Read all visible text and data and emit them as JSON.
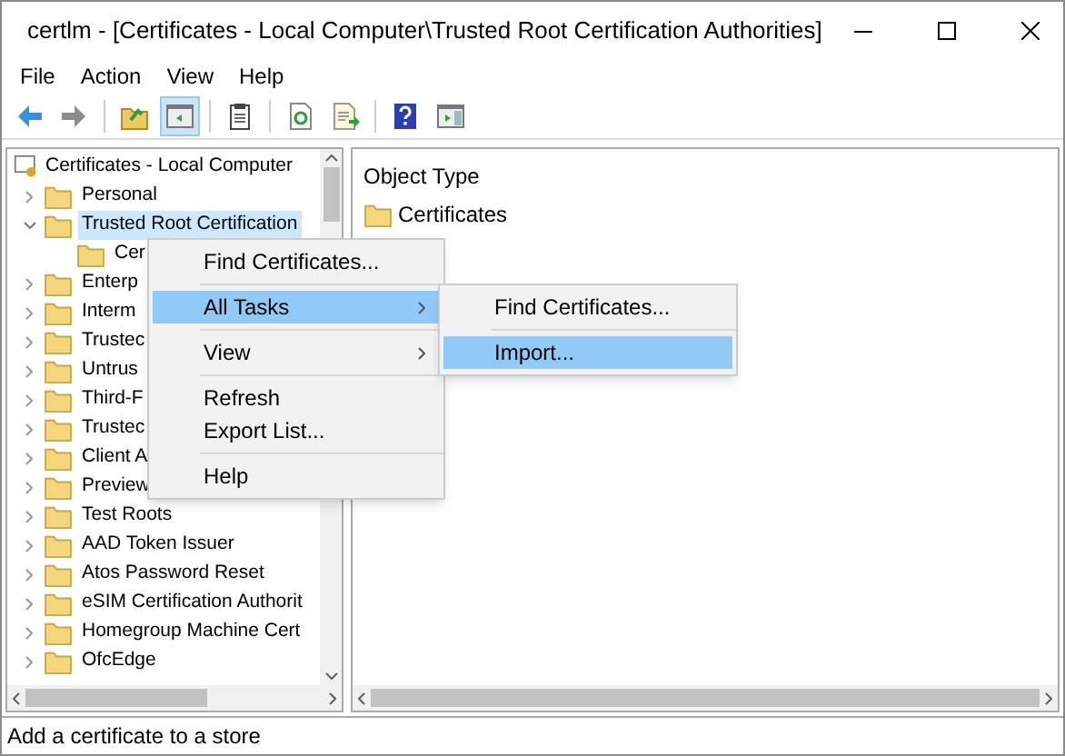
{
  "window": {
    "title": "certlm - [Certificates - Local Computer\\Trusted Root Certification Authorities]"
  },
  "menu_bar": [
    "File",
    "Action",
    "View",
    "Help"
  ],
  "toolbar": [
    {
      "kind": "back",
      "selected": false
    },
    {
      "kind": "forward",
      "selected": false
    },
    {
      "kind": "up",
      "selected": false
    },
    {
      "kind": "tree",
      "selected": true
    },
    {
      "kind": "clipboard",
      "selected": false
    },
    {
      "kind": "refresh",
      "selected": false
    },
    {
      "kind": "export",
      "selected": false
    },
    {
      "kind": "help",
      "selected": false
    },
    {
      "kind": "panel",
      "selected": false
    }
  ],
  "tree": {
    "label": "Certificates - Local Computer",
    "children": [
      {
        "label": "Personal",
        "expanded": false,
        "selected": false
      },
      {
        "label": "Trusted Root Certification",
        "expanded": true,
        "selected": true,
        "children": [
          {
            "label": "Cer",
            "selected": false
          }
        ]
      },
      {
        "label": "Enterp",
        "expanded": false,
        "selected": false
      },
      {
        "label": "Interm",
        "expanded": false,
        "selected": false
      },
      {
        "label": "Trustec",
        "expanded": false,
        "selected": false
      },
      {
        "label": "Untrus",
        "expanded": false,
        "selected": false
      },
      {
        "label": "Third-F",
        "expanded": false,
        "selected": false
      },
      {
        "label": "Trustec",
        "expanded": false,
        "selected": false
      },
      {
        "label": "Client A",
        "expanded": false,
        "selected": false
      },
      {
        "label": "Preview",
        "expanded": false,
        "selected": false
      },
      {
        "label": "Test Roots",
        "expanded": false,
        "selected": false
      },
      {
        "label": "AAD Token Issuer",
        "expanded": false,
        "selected": false
      },
      {
        "label": "Atos Password Reset",
        "expanded": false,
        "selected": false
      },
      {
        "label": "eSIM Certification Authorit",
        "expanded": false,
        "selected": false
      },
      {
        "label": "Homegroup Machine Cert",
        "expanded": false,
        "selected": false
      },
      {
        "label": "OfcEdge",
        "expanded": false,
        "selected": false
      }
    ]
  },
  "list": {
    "column": "Object Type",
    "items": [
      "Certificates"
    ]
  },
  "context_menu": [
    {
      "kind": "item",
      "label": "Find Certificates...",
      "submenu": false,
      "selected": false
    },
    {
      "kind": "separator"
    },
    {
      "kind": "item",
      "label": "All Tasks",
      "submenu": true,
      "selected": true
    },
    {
      "kind": "separator"
    },
    {
      "kind": "item",
      "label": "View",
      "submenu": true,
      "selected": false
    },
    {
      "kind": "separator"
    },
    {
      "kind": "item",
      "label": "Refresh",
      "submenu": false,
      "selected": false
    },
    {
      "kind": "item",
      "label": "Export List...",
      "submenu": false,
      "selected": false
    },
    {
      "kind": "separator"
    },
    {
      "kind": "item",
      "label": "Help",
      "submenu": false,
      "selected": false
    }
  ],
  "submenu": [
    {
      "kind": "item",
      "label": "Find Certificates...",
      "selected": false
    },
    {
      "kind": "separator"
    },
    {
      "kind": "item",
      "label": "Import...",
      "selected": true
    }
  ],
  "status_bar": "Add a certificate to a store"
}
